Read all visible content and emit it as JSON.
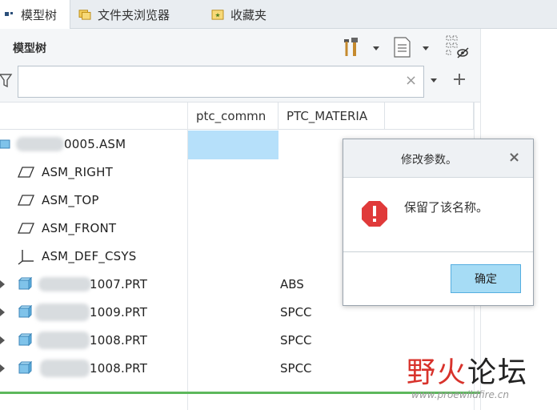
{
  "tabs": [
    {
      "label": "模型树",
      "icon": "tree-icon",
      "active": true
    },
    {
      "label": "文件夹浏览器",
      "icon": "folder-browser-icon",
      "active": false
    },
    {
      "label": "收藏夹",
      "icon": "favorites-icon",
      "active": false
    }
  ],
  "panel": {
    "title": "模型树"
  },
  "filter": {
    "value": "",
    "placeholder": ""
  },
  "columns": [
    {
      "label": "ptc_commn"
    },
    {
      "label": "PTC_MATERIA"
    }
  ],
  "rows": [
    {
      "name": "0005.ASM",
      "material": "",
      "type": "assembly",
      "expandable": true
    },
    {
      "name": "ASM_RIGHT",
      "material": "",
      "type": "datum-plane",
      "expandable": false
    },
    {
      "name": "ASM_TOP",
      "material": "",
      "type": "datum-plane",
      "expandable": false
    },
    {
      "name": "ASM_FRONT",
      "material": "",
      "type": "datum-plane",
      "expandable": false
    },
    {
      "name": "ASM_DEF_CSYS",
      "material": "",
      "type": "csys",
      "expandable": false
    },
    {
      "name": "1007.PRT",
      "material": "ABS",
      "type": "part",
      "expandable": true
    },
    {
      "name": "1009.PRT",
      "material": "SPCC",
      "type": "part",
      "expandable": true
    },
    {
      "name": "1008.PRT",
      "material": "SPCC",
      "type": "part",
      "expandable": true
    },
    {
      "name": "1008.PRT",
      "material": "SPCC",
      "type": "part",
      "expandable": true
    }
  ],
  "dialog": {
    "title": "修改参数。",
    "message": "保留了该名称。",
    "ok_label": "确定",
    "icon": "error-icon"
  },
  "watermark": {
    "chinese": "野火论坛",
    "url": "www.proewildfire.cn"
  },
  "colors": {
    "accent_blue": "#a6dcf5",
    "selection": "#b6e0fa",
    "error_red": "#e03a3a",
    "progress_green": "#5db85c"
  }
}
